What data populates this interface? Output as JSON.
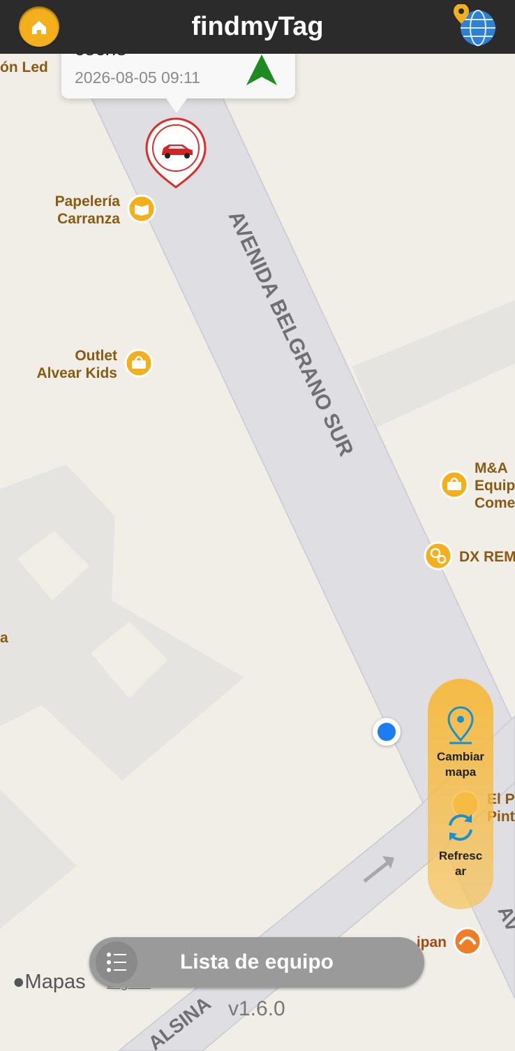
{
  "header": {
    "title": "findmyTag",
    "home_icon": "home-icon",
    "map_icon": "globe-pin-icon"
  },
  "popup": {
    "device_name": "coche",
    "timestamp": "2026-08-05 09:11",
    "arrow_icon": "green-north-arrow-icon"
  },
  "map": {
    "road_main": "AVENIDA BELGRANO SUR",
    "road_cross": "ALSINA",
    "road_right_fragment": "AV",
    "pois": [
      {
        "line1": "ón Led",
        "line2": ""
      },
      {
        "line1": "Papelería",
        "line2": "Carranza",
        "icon": "book-icon"
      },
      {
        "line1": "Outlet",
        "line2": "Alvear Kids",
        "icon": "shopping-bag-icon"
      },
      {
        "line1": "M&A",
        "line2": "Equip",
        "line3": "Come",
        "icon": "shopping-bag-icon"
      },
      {
        "line1": "DX REM",
        "icon": "gears-icon"
      },
      {
        "line1": "El P",
        "line2": "Pint",
        "icon": "shopping-bag-icon"
      },
      {
        "line1": "ipan",
        "icon": "croissant-icon"
      },
      {
        "line1": "a"
      }
    ]
  },
  "side_panel": {
    "change_map_label_1": "Cambiar",
    "change_map_label_2": "mapa",
    "refresh_label_1": "Refresc",
    "refresh_label_2": "ar"
  },
  "bottom": {
    "list_label": "Lista de equipo",
    "maps_brand": "Mapas",
    "legal": "Legales",
    "version": "v1.6.0"
  },
  "colors": {
    "accent": "#f4b01c",
    "topbar": "#2b2b2b",
    "marker": "#e02b2b",
    "poi_text": "#8a5a12",
    "user_dot": "#1d7cf2"
  }
}
